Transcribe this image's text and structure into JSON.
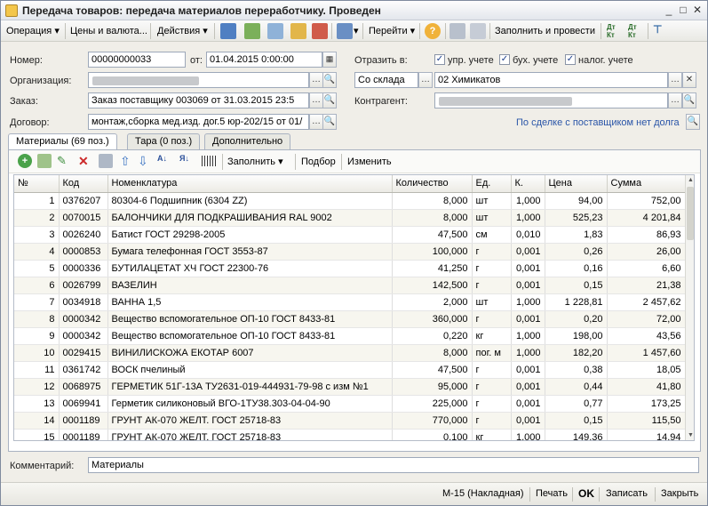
{
  "window": {
    "title": "Передача товаров: передача материалов переработчику. Проведен"
  },
  "toolbar": {
    "operation": "Операция",
    "prices": "Цены и валюта...",
    "actions": "Действия",
    "goto": "Перейти",
    "fill_and_post": "Заполнить и провести"
  },
  "header": {
    "number_label": "Номер:",
    "number_value": "00000000033",
    "date_label": "от:",
    "date_value": "01.04.2015  0:00:00",
    "reflect_label": "Отразить в:",
    "cb_mgmt": "упр. учете",
    "cb_acc": "бух. учете",
    "cb_tax": "налог. учете",
    "org_label": "Организация:",
    "warehouse_type": "Со склада",
    "warehouse_value": "02 Химикатов",
    "order_label": "Заказ:",
    "order_value": "Заказ поставщику 003069 от 31.03.2015 23:5",
    "contractor_label": "Контрагент:",
    "contract_label": "Договор:",
    "contract_value": "монтаж,сборка мед.изд. дог.5 юр-202/15 от 01/",
    "debt_link": "По сделке с поставщиком нет долга"
  },
  "tabs": [
    {
      "label": "Материалы (69 поз.)"
    },
    {
      "label": "Тара (0 поз.)"
    },
    {
      "label": "Дополнительно"
    }
  ],
  "inner_toolbar": {
    "fill": "Заполнить",
    "selection": "Подбор",
    "change": "Изменить"
  },
  "table": {
    "headers": [
      "№",
      "Код",
      "Номенклатура",
      "Количество",
      "Ед.",
      "К.",
      "Цена",
      "Сумма"
    ],
    "rows": [
      [
        "1",
        "0376207",
        "80304-6 Подшипник (6304 ZZ)",
        "8,000",
        "шт",
        "1,000",
        "94,00",
        "752,00"
      ],
      [
        "2",
        "0070015",
        "БАЛОНЧИКИ ДЛЯ ПОДКРАШИВАНИЯ RAL 9002",
        "8,000",
        "шт",
        "1,000",
        "525,23",
        "4 201,84"
      ],
      [
        "3",
        "0026240",
        "Батист ГОСТ 29298-2005",
        "47,500",
        "см",
        "0,010",
        "1,83",
        "86,93"
      ],
      [
        "4",
        "0000853",
        "Бумага телефонная ГОСТ 3553-87",
        "100,000",
        "г",
        "0,001",
        "0,26",
        "26,00"
      ],
      [
        "5",
        "0000336",
        "БУТИЛАЦЕТАТ ХЧ ГОСТ 22300-76",
        "41,250",
        "г",
        "0,001",
        "0,16",
        "6,60"
      ],
      [
        "6",
        "0026799",
        "ВАЗЕЛИН",
        "142,500",
        "г",
        "0,001",
        "0,15",
        "21,38"
      ],
      [
        "7",
        "0034918",
        "ВАННА 1,5",
        "2,000",
        "шт",
        "1,000",
        "1 228,81",
        "2 457,62"
      ],
      [
        "8",
        "0000342",
        "Вещество вспомогательное ОП-10 ГОСТ 8433-81",
        "360,000",
        "г",
        "0,001",
        "0,20",
        "72,00"
      ],
      [
        "9",
        "0000342",
        "Вещество вспомогательное ОП-10 ГОСТ 8433-81",
        "0,220",
        "кг",
        "1,000",
        "198,00",
        "43,56"
      ],
      [
        "10",
        "0029415",
        "ВИНИЛИСКОЖА ЕКОТАР 6007",
        "8,000",
        "пог. м",
        "1,000",
        "182,20",
        "1 457,60"
      ],
      [
        "11",
        "0361742",
        "ВОСК пчелиный",
        "47,500",
        "г",
        "0,001",
        "0,38",
        "18,05"
      ],
      [
        "12",
        "0068975",
        "ГЕРМЕТИК 51Г-13А ТУ2631-019-444931-79-98 с изм №1",
        "95,000",
        "г",
        "0,001",
        "0,44",
        "41,80"
      ],
      [
        "13",
        "0069941",
        "Герметик силиконовый ВГО-1ТУ38.303-04-04-90",
        "225,000",
        "г",
        "0,001",
        "0,77",
        "173,25"
      ],
      [
        "14",
        "0001189",
        "ГРУНТ АК-070 ЖЕЛТ. ГОСТ 25718-83",
        "770,000",
        "г",
        "0,001",
        "0,15",
        "115,50"
      ],
      [
        "15",
        "0001189",
        "ГРУНТ АК-070 ЖЕЛТ. ГОСТ 25718-83",
        "0,100",
        "кг",
        "1,000",
        "149,36",
        "14,94"
      ]
    ]
  },
  "footer": {
    "comment_label": "Комментарий:",
    "comment_value": "Материалы"
  },
  "statusbar": {
    "m15": "М-15 (Накладная)",
    "print": "Печать",
    "ok": "OK",
    "save": "Записать",
    "close": "Закрыть"
  }
}
